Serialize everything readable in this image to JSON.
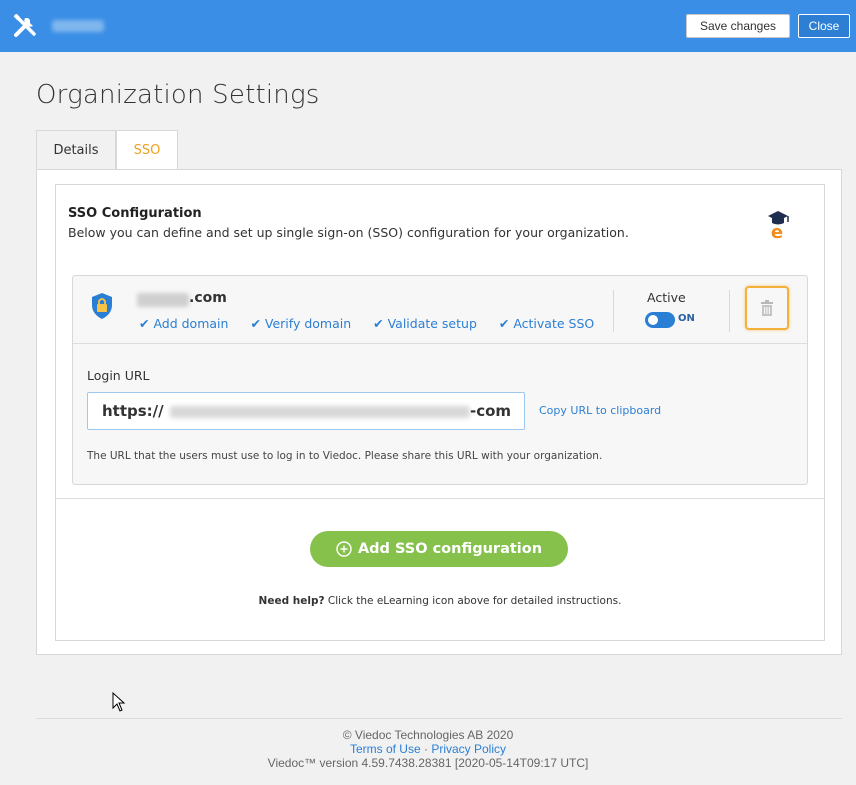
{
  "toolbar": {
    "save_label": "Save changes",
    "close_label": "Close"
  },
  "page": {
    "title": "Organization Settings"
  },
  "tabs": [
    {
      "label": "Details"
    },
    {
      "label": "SSO"
    }
  ],
  "sso": {
    "title": "SSO Configuration",
    "description": "Below you can define and set up single sign-on (SSO) configuration for your organization.",
    "domain_suffix": ".com",
    "steps": [
      "Add domain",
      "Verify domain",
      "Validate setup",
      "Activate SSO"
    ],
    "active_label": "Active",
    "toggle_state": "ON",
    "login_url_label": "Login URL",
    "login_url_prefix": "https://",
    "login_url_suffix": "-com",
    "copy_link": "Copy URL to clipboard",
    "url_note": "The URL that the users must use to log in to Viedoc. Please share this URL with your organization.",
    "add_button": "Add SSO configuration",
    "help_bold": "Need help?",
    "help_text": " Click the eLearning icon above for detailed instructions."
  },
  "footer": {
    "copyright": "© Viedoc Technologies AB 2020",
    "terms": "Terms of Use",
    "separator": " · ",
    "privacy": "Privacy Policy",
    "version": "Viedoc™ version 4.59.7438.28381 [2020-05-14T09:17 UTC]"
  },
  "colors": {
    "topbar": "#3a8ee6",
    "accent_orange": "#f0a020",
    "link_blue": "#2a7fd4",
    "add_green": "#86c14c"
  }
}
